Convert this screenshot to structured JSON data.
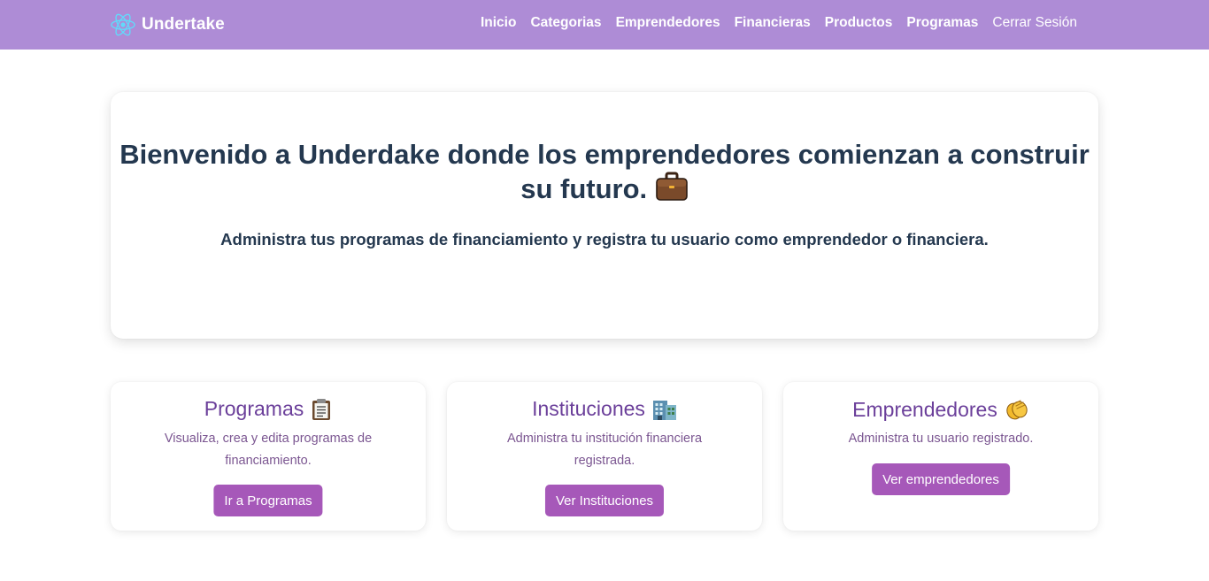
{
  "brand": {
    "name": "Undertake",
    "logo_icon": "react-atom-icon",
    "logo_color": "#61dafb"
  },
  "nav": {
    "links": [
      "Inicio",
      "Categorias",
      "Emprendedores",
      "Financieras",
      "Productos",
      "Programas"
    ],
    "logout": "Cerrar Sesión"
  },
  "hero": {
    "title_line1": "Bienvenido a Underdake donde los emprendedores comienzan a construir",
    "title_line2": "su futuro.",
    "title_icon": "briefcase-icon",
    "subtitle": "Administra tus programas de financiamiento y registra tu usuario como emprendedor o financiera."
  },
  "cards": [
    {
      "title": "Programas",
      "icon": "clipboard-icon",
      "description": "Visualiza, crea y edita programas de financiamiento.",
      "button": "Ir a Programas"
    },
    {
      "title": "Instituciones",
      "icon": "office-building-icon",
      "description": "Administra tu institución financiera registrada.",
      "button": "Ver Instituciones"
    },
    {
      "title": "Emprendedores",
      "icon": "clapping-hands-icon",
      "description": "Administra tu usuario registrado.",
      "button": "Ver emprendedores"
    }
  ],
  "colors": {
    "navbar": "#ae8cd6",
    "heading": "#24384f",
    "card_title": "#6b3f9a",
    "card_text": "#7b5691",
    "button": "#a658b9"
  }
}
